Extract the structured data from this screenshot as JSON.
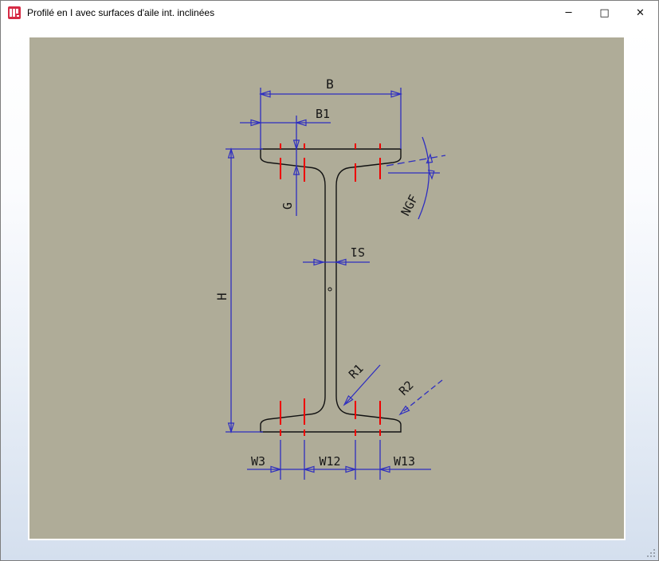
{
  "window": {
    "title": "Profilé en I avec surfaces d'aile int. inclinées",
    "controls": {
      "minimize_glyph": "─",
      "maximize_glyph": "□",
      "close_glyph": "✕"
    }
  },
  "drawing": {
    "background_color": "#afac98",
    "outline_color": "#121212",
    "dimension_color": "#2e2ec0",
    "gauge_line_color": "#ee0000",
    "labels": {
      "flange_width": "B",
      "flange_quarter_point": "B1",
      "flange_thickness": "G",
      "profile_height": "H",
      "web_thickness": "S1",
      "flange_slope_angle": "NGF",
      "root_radius": "R1",
      "toe_radius": "R2",
      "gauge_left": "W3",
      "gauge_middle": "W12",
      "gauge_right": "W13"
    }
  }
}
